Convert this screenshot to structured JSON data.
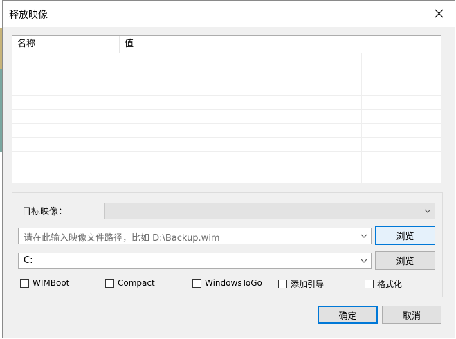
{
  "window": {
    "title": "释放映像"
  },
  "listview": {
    "columns": [
      "名称",
      "值"
    ]
  },
  "form": {
    "target_image_label": "目标映像：",
    "target_image_value": "",
    "path_placeholder": "请在此输入映像文件路径，比如 D:\\Backup.wim",
    "browse1_label": "浏览",
    "drive_value": "C:",
    "browse2_label": "浏览",
    "options": [
      {
        "label": "WIMBoot",
        "checked": false
      },
      {
        "label": "Compact",
        "checked": false
      },
      {
        "label": "WindowsToGo",
        "checked": false
      },
      {
        "label": "添加引导",
        "checked": false
      },
      {
        "label": "格式化",
        "checked": false
      }
    ]
  },
  "buttons": {
    "ok": "确定",
    "cancel": "取消"
  },
  "icons": {
    "close": "close-icon",
    "dropdown": "chevron-down-icon"
  },
  "colors": {
    "accent": "#0078d7",
    "background": "#f0f0f0"
  }
}
